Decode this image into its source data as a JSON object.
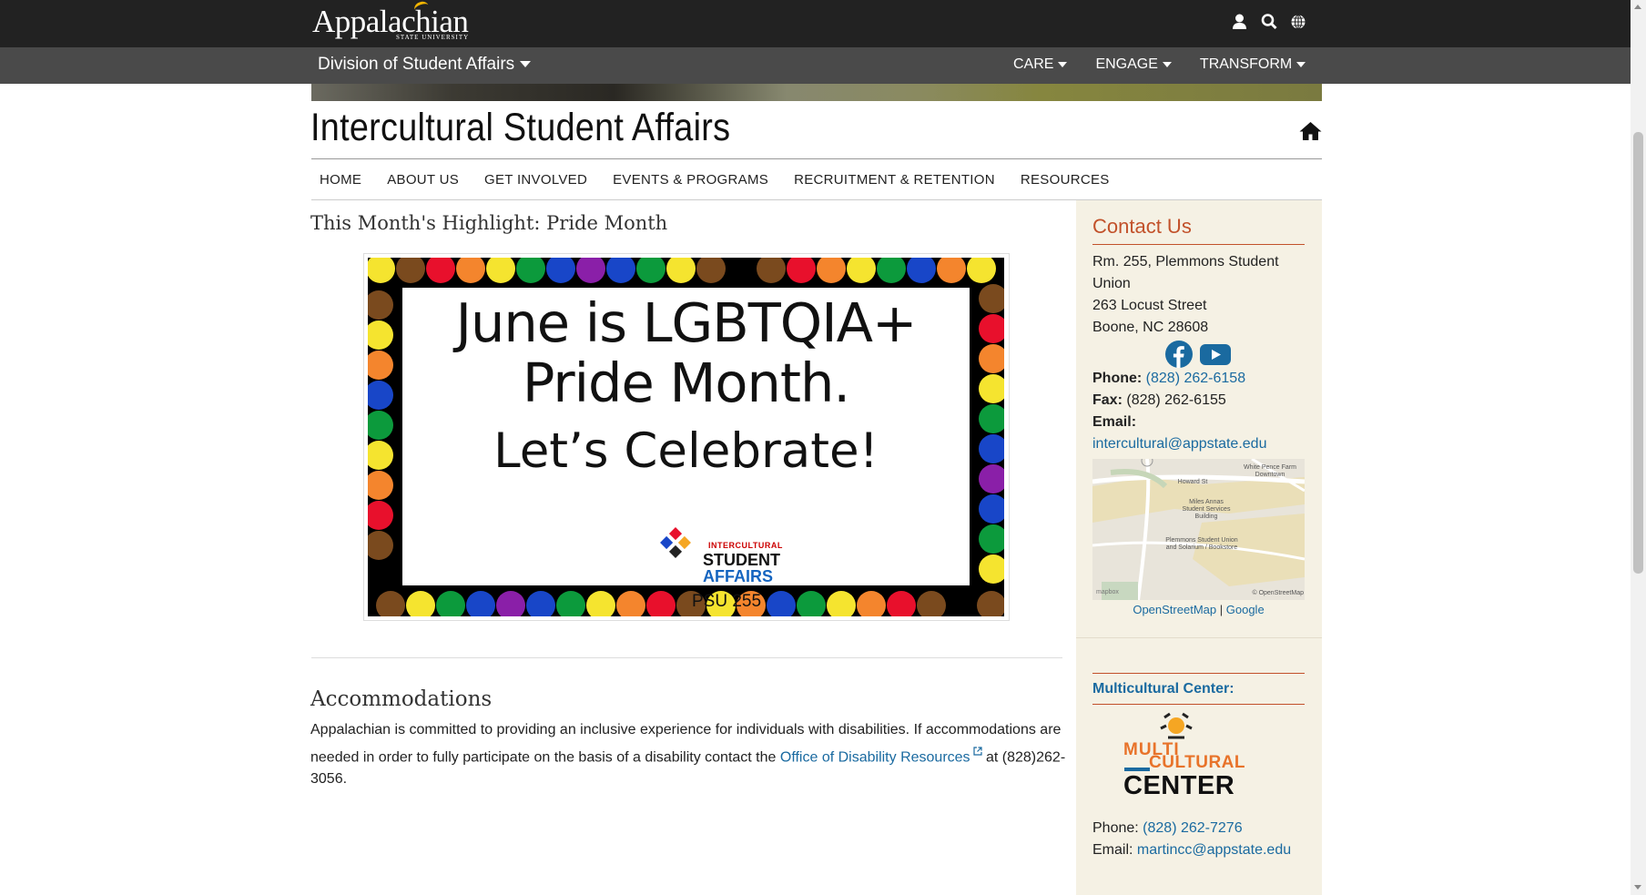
{
  "header": {
    "logo_text": "Appalachian",
    "logo_sub": "STATE UNIVERSITY",
    "icons": [
      "user-icon",
      "search-icon",
      "globe-icon"
    ]
  },
  "subnav": {
    "division": "Division of Student Affairs",
    "items": [
      "CARE",
      "ENGAGE",
      "TRANSFORM"
    ]
  },
  "site": {
    "title": "Intercultural Student Affairs",
    "nav": [
      "HOME",
      "ABOUT US",
      "GET INVOLVED",
      "EVENTS & PROGRAMS",
      "RECRUITMENT & RETENTION",
      "RESOURCES"
    ]
  },
  "main": {
    "highlight_title": "This Month's Highlight: Pride Month",
    "poster": {
      "line1": "June is LGBTQIA+",
      "line2": "Pride Month.",
      "line3": "Let’s Celebrate!",
      "org_tag": "INTERCULTURAL",
      "org_line1": "STUDENT",
      "org_line2": "AFFAIRS",
      "room": "PSU 255",
      "colors": [
        "#f5e42f",
        "#7a4a1e",
        "#e8102c",
        "#f4852d",
        "#f5e42f",
        "#0c9a3c",
        "#1846c8",
        "#8a1fa8",
        "#1846c8",
        "#0c9a3c",
        "#f5e42f",
        "#7a4a1e",
        "#000000",
        "#7a4a1e",
        "#e8102c",
        "#f4852d",
        "#f5e42f",
        "#0c9a3c",
        "#1846c8",
        "#f4852d"
      ]
    },
    "accommodations": {
      "title": "Accommodations",
      "text_before": "Appalachian is committed to providing an inclusive experience for individuals with disabilities. If accommodations are needed in order to fully participate on the basis of a disability contact the ",
      "link_text": "Office of Disability Resources",
      "text_after": " at (828)262-3056."
    }
  },
  "sidebar": {
    "contact_title": "Contact Us",
    "address1": "Rm. 255, Plemmons Student Union",
    "address2": "263 Locust Street",
    "address3": "Boone, NC 28608",
    "phone_label": "Phone:",
    "phone": "(828) 262-6158",
    "fax_label": "Fax:",
    "fax": "(828) 262-6155",
    "email_label": "Email:",
    "email": "intercultural@appstate.edu",
    "map_labels": {
      "street": "Howard St",
      "building1": "Miles Annas Student Services Building",
      "building2": "Plemmons Student Union and Solarium / Bookstore",
      "park": "White Pence Farm Downtown",
      "mapbox": "mapbox",
      "osm_attrib": "© OpenStreetMap"
    },
    "map_link1": "OpenStreetMap",
    "map_sep": "|",
    "map_link2": "Google",
    "mc_title": "Multicultural Center:",
    "mc_logo_line1": "MULTI",
    "mc_logo_line2": "CULTURAL",
    "mc_logo_line3": "CENTER",
    "mc_phone_label": "Phone:",
    "mc_phone": "(828) 262-7276",
    "mc_email_label": "Email:",
    "mc_email": "martincc@appstate.edu"
  },
  "colors": {
    "topbar": "#222222",
    "subbar": "#4a4a4a",
    "accent_orange": "#c2512a",
    "link_blue": "#1a6aa0",
    "sidebar_bg": "#f5f1e4"
  }
}
